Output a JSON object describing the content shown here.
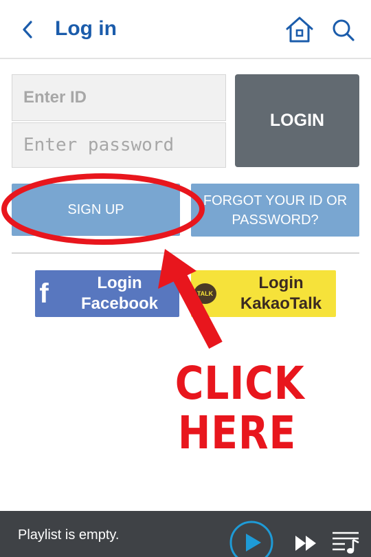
{
  "header": {
    "title": "Log in",
    "back_icon": "chevron-left-icon",
    "home_icon": "home-icon",
    "search_icon": "search-icon"
  },
  "form": {
    "id_placeholder": "Enter ID",
    "password_placeholder": "Enter password",
    "login_label": "LOGIN",
    "signup_label": "SIGN UP",
    "forgot_label": "FORGOT YOUR ID OR PASSWORD?"
  },
  "social": {
    "facebook_icon": "facebook-icon",
    "facebook_label": "Login\nFacebook",
    "kakao_icon_text": "TALK",
    "kakao_label": "Login\nKakaoTalk"
  },
  "annotation": {
    "text": "CLICK\nHERE",
    "color": "#e8161d"
  },
  "player": {
    "status": "Playlist is empty.",
    "play_icon": "play-icon",
    "fast_forward_icon": "fast-forward-icon",
    "queue_icon": "playlist-icon"
  },
  "colors": {
    "accent": "#1b5cab",
    "login_button": "#626a71",
    "secondary_button": "#79a6d1",
    "facebook": "#5877bf",
    "kakao": "#f6e23a",
    "player_bar": "#3f4246"
  }
}
